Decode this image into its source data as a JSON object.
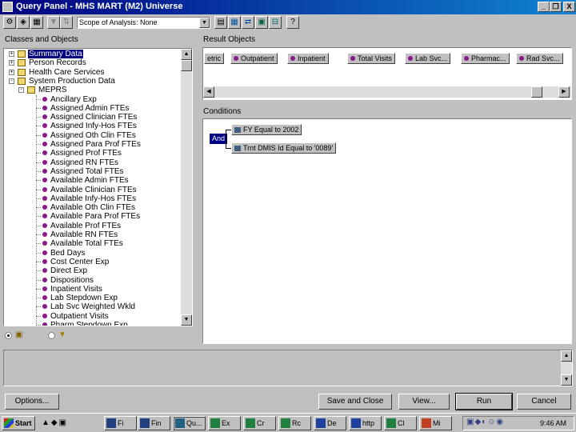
{
  "window": {
    "title": "Query Panel - MHS MART (M2) Universe",
    "controls": {
      "minimize": "_",
      "restore": "❐",
      "close": "X"
    }
  },
  "toolbar": {
    "scope_value": "Scope of Analysis: None",
    "icons": [
      "query-panel-icon",
      "options-icon",
      "sql-icon",
      "filter-icon",
      "sort-icon",
      "view-icon",
      "link-icon",
      "calc-icon",
      "help-icon"
    ]
  },
  "classes_panel": {
    "label": "Classes and Objects",
    "items": [
      {
        "kind": "class",
        "label": "Summary Data",
        "expander": "+",
        "selected": true
      },
      {
        "kind": "class",
        "label": "Person Records",
        "expander": "+"
      },
      {
        "kind": "class",
        "label": "Health Care Services",
        "expander": "+"
      },
      {
        "kind": "class",
        "label": "System Production Data",
        "expander": "-"
      },
      {
        "kind": "class",
        "label": "MEPRS",
        "expander": "-"
      },
      {
        "kind": "object",
        "label": "Ancillary Exp"
      },
      {
        "kind": "object",
        "label": "Assigned Admin FTEs"
      },
      {
        "kind": "object",
        "label": "Assigned Clinician FTEs"
      },
      {
        "kind": "object",
        "label": "Assigned Infy-Hos FTEs"
      },
      {
        "kind": "object",
        "label": "Assigned Oth Clin FTEs"
      },
      {
        "kind": "object",
        "label": "Assigned Para Prof FTEs"
      },
      {
        "kind": "object",
        "label": "Assigned Prof FTEs"
      },
      {
        "kind": "object",
        "label": "Assigned RN FTEs"
      },
      {
        "kind": "object",
        "label": "Assigned Total FTEs"
      },
      {
        "kind": "object",
        "label": "Available Admin FTEs"
      },
      {
        "kind": "object",
        "label": "Available Clinician FTEs"
      },
      {
        "kind": "object",
        "label": "Available Infy-Hos FTEs"
      },
      {
        "kind": "object",
        "label": "Available Oth Clin FTEs"
      },
      {
        "kind": "object",
        "label": "Available Para Prof FTEs"
      },
      {
        "kind": "object",
        "label": "Available Prof FTEs"
      },
      {
        "kind": "object",
        "label": "Available RN FTEs"
      },
      {
        "kind": "object",
        "label": "Available Total FTEs"
      },
      {
        "kind": "object",
        "label": "Bed Days"
      },
      {
        "kind": "object",
        "label": "Cost Center Exp"
      },
      {
        "kind": "object",
        "label": "Direct Exp"
      },
      {
        "kind": "object",
        "label": "Dispositions"
      },
      {
        "kind": "object",
        "label": "Inpatient Visits"
      },
      {
        "kind": "object",
        "label": "Lab Stepdown Exp"
      },
      {
        "kind": "object",
        "label": "Lab Svc Weighted Wkld"
      },
      {
        "kind": "object",
        "label": "Outpatient Visits"
      },
      {
        "kind": "object",
        "label": "Pharm Stepdown Exp"
      }
    ],
    "view_modes": {
      "classes_icon": "classes-objects-icon",
      "filters_icon": "predefined-filters-icon"
    }
  },
  "result_objects": {
    "label": "Result Objects",
    "items": [
      "etric",
      "Outpatient",
      "Inpatient",
      "Total Visits",
      "Lab Svc...",
      "Pharmac...",
      "Rad Svc..."
    ]
  },
  "conditions": {
    "label": "Conditions",
    "operator": "And",
    "items": [
      "FY Equal to 2002",
      "Trnt DMIS Id Equal to '0089'"
    ]
  },
  "buttons": {
    "options": "Options...",
    "save_close": "Save and Close",
    "view": "View...",
    "run": "Run",
    "cancel": "Cancel"
  },
  "taskbar": {
    "start": "Start",
    "tasks": [
      "Fi",
      "Fin",
      "Qu...",
      "Ex",
      "Cr",
      "Rc",
      "De",
      "http",
      "Cl",
      "Mi"
    ],
    "clock": "9:46 AM"
  }
}
